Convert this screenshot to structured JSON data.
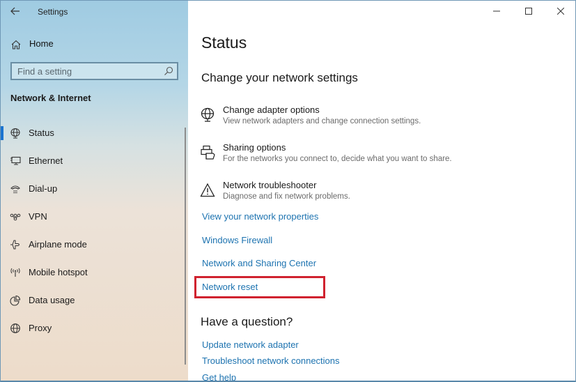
{
  "window": {
    "app_title": "Settings",
    "controls": {
      "minimize": "minimize-icon",
      "maximize": "maximize-icon",
      "close": "close-icon"
    }
  },
  "sidebar": {
    "back_icon": "back-arrow-icon",
    "home": {
      "label": "Home",
      "icon": "home-icon"
    },
    "search": {
      "placeholder": "Find a setting",
      "value": "",
      "icon": "search-icon"
    },
    "section_title": "Network & Internet",
    "items": [
      {
        "label": "Status",
        "icon": "status-globe-icon",
        "active": true
      },
      {
        "label": "Ethernet",
        "icon": "ethernet-icon",
        "active": false
      },
      {
        "label": "Dial-up",
        "icon": "dialup-icon",
        "active": false
      },
      {
        "label": "VPN",
        "icon": "vpn-icon",
        "active": false
      },
      {
        "label": "Airplane mode",
        "icon": "airplane-icon",
        "active": false
      },
      {
        "label": "Mobile hotspot",
        "icon": "hotspot-icon",
        "active": false
      },
      {
        "label": "Data usage",
        "icon": "data-usage-icon",
        "active": false
      },
      {
        "label": "Proxy",
        "icon": "proxy-globe-icon",
        "active": false
      }
    ],
    "accent_color": "#1a73d0"
  },
  "main": {
    "page_title": "Status",
    "change_settings_heading": "Change your network settings",
    "options": [
      {
        "title": "Change adapter options",
        "description": "View network adapters and change connection settings.",
        "icon": "adapter-globe-icon"
      },
      {
        "title": "Sharing options",
        "description": "For the networks you connect to, decide what you want to share.",
        "icon": "sharing-icon"
      },
      {
        "title": "Network troubleshooter",
        "description": "Diagnose and fix network problems.",
        "icon": "warning-icon"
      }
    ],
    "links": [
      "View your network properties",
      "Windows Firewall",
      "Network and Sharing Center",
      "Network reset"
    ],
    "highlighted_link": "Network reset",
    "highlight_color": "#d0222f",
    "question_heading": "Have a question?",
    "help_links": [
      "Update network adapter",
      "Troubleshoot network connections",
      "Get help"
    ],
    "link_color": "#1d73b0"
  }
}
